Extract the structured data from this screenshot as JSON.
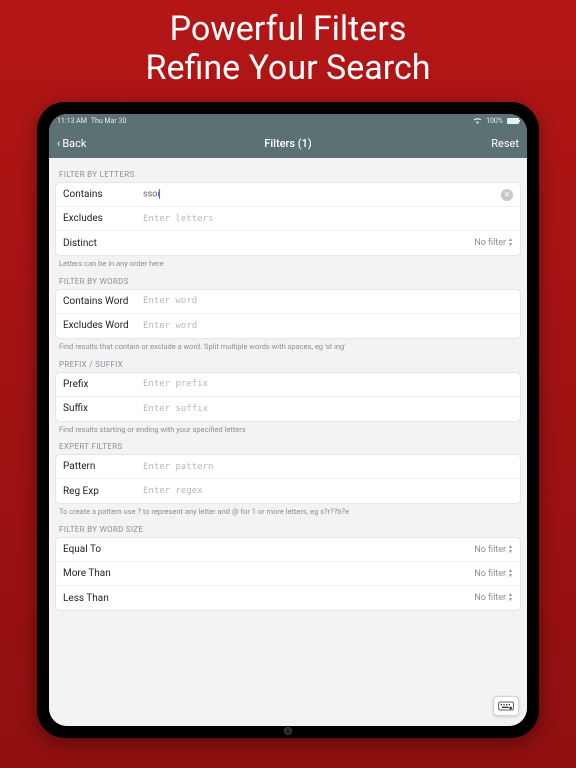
{
  "hero": {
    "line1": "Powerful Filters",
    "line2": "Refine Your Search"
  },
  "status": {
    "time": "11:13 AM",
    "date": "Thu Mar 30",
    "wifi": "100%"
  },
  "nav": {
    "back": "Back",
    "title": "Filters (1)",
    "reset": "Reset"
  },
  "sections": {
    "letters": {
      "header": "FILTER BY LETTERS",
      "contains_label": "Contains",
      "contains_value": "ssor",
      "excludes_label": "Excludes",
      "excludes_placeholder": "Enter letters",
      "distinct_label": "Distinct",
      "distinct_value": "No filter",
      "hint": "Letters can be in any order here"
    },
    "words": {
      "header": "FILTER BY WORDS",
      "contains_label": "Contains Word",
      "contains_placeholder": "Enter word",
      "excludes_label": "Excludes Word",
      "excludes_placeholder": "Enter word",
      "hint": "Find results that contain or exclude a word. Split multiple words with spaces, eg 'st ing'"
    },
    "prefix": {
      "header": "PREFIX / SUFFIX",
      "prefix_label": "Prefix",
      "prefix_placeholder": "Enter prefix",
      "suffix_label": "Suffix",
      "suffix_placeholder": "Enter suffix",
      "hint": "Find results starting or ending with your specified letters"
    },
    "expert": {
      "header": "EXPERT FILTERS",
      "pattern_label": "Pattern",
      "pattern_placeholder": "Enter pattern",
      "regex_label": "Reg Exp",
      "regex_placeholder": "Enter regex",
      "hint": "To create a pattern use ? to represent any letter and @ for 1 or more letters, eg s?r??b?e"
    },
    "size": {
      "header": "FILTER BY WORD SIZE",
      "equal_label": "Equal To",
      "equal_value": "No filter",
      "more_label": "More Than",
      "more_value": "No filter",
      "less_label": "Less Than",
      "less_value": "No filter"
    }
  }
}
